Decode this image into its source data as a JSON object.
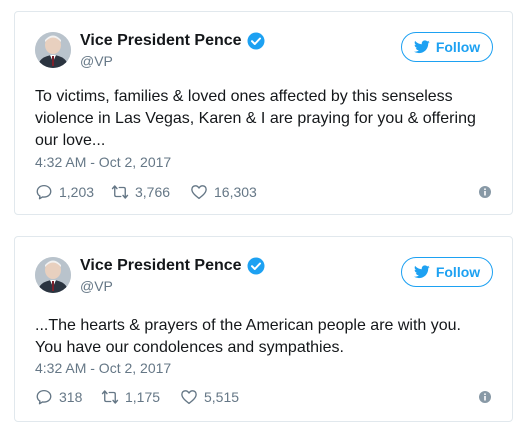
{
  "tweets": [
    {
      "name": "Vice President Pence",
      "handle": "@VP",
      "follow_label": "Follow",
      "text": "To victims, families & loved ones affected by this senseless violence in Las Vegas, Karen & I are praying for you & offering our love...",
      "timestamp": "4:32 AM - Oct 2, 2017",
      "replies": "1,203",
      "retweets": "3,766",
      "likes": "16,303"
    },
    {
      "name": "Vice President Pence",
      "handle": "@VP",
      "follow_label": "Follow",
      "text": "...The hearts & prayers of the American people are with you. You have our condolences and sympathies.",
      "timestamp": "4:32 AM - Oct 2, 2017",
      "replies": "318",
      "retweets": "1,175",
      "likes": "5,515"
    }
  ],
  "colors": {
    "accent": "#1da1f2",
    "secondary_text": "#657786",
    "border": "#e1e8ed"
  },
  "icons": [
    "avatar",
    "verified-badge-icon",
    "twitter-bird-icon",
    "reply-icon",
    "retweet-icon",
    "like-icon",
    "info-icon"
  ]
}
